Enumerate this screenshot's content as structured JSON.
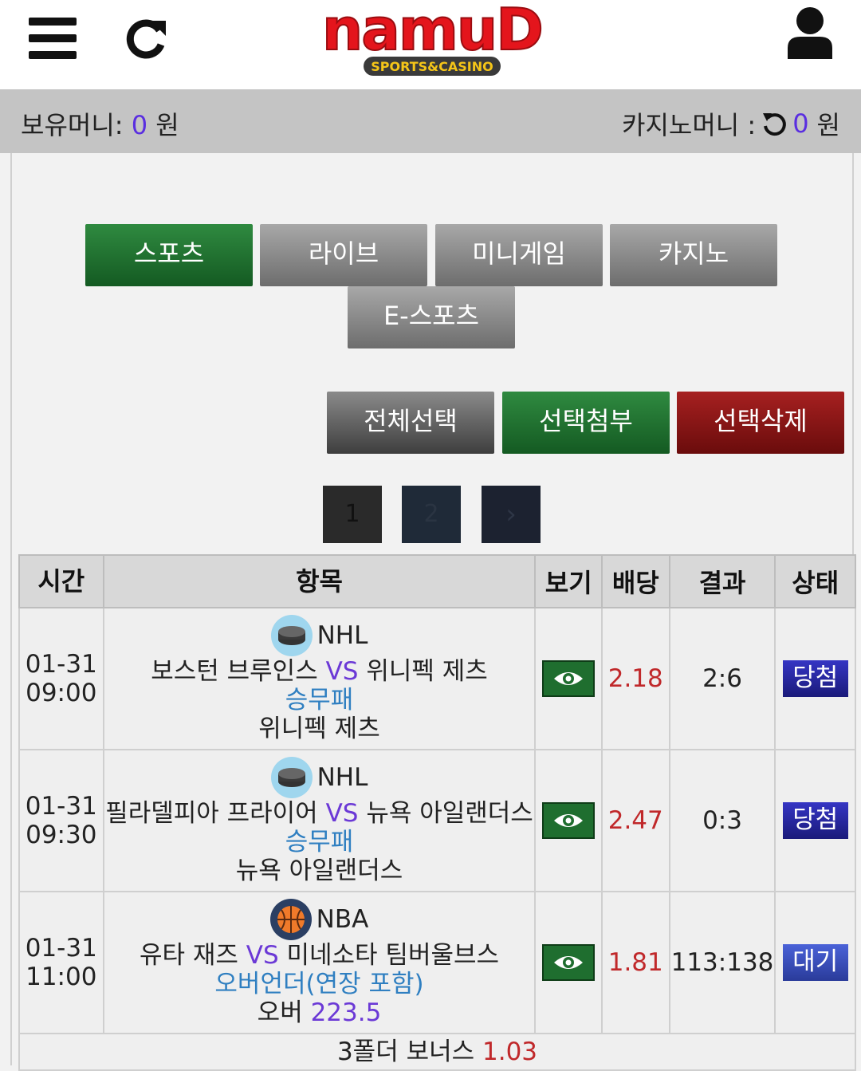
{
  "header": {
    "logo_main": "namuD",
    "logo_sub": "SPORTS&CASINO"
  },
  "money": {
    "hold_label": "보유머니:",
    "hold_value": "0",
    "hold_unit": "원",
    "casino_label": "카지노머니 :",
    "casino_value": "0",
    "casino_unit": "원"
  },
  "tabs": {
    "sports": "스포츠",
    "live": "라이브",
    "minigame": "미니게임",
    "casino": "카지노",
    "esports": "E-스포츠"
  },
  "actions": {
    "select_all": "전체선택",
    "attach": "선택첨부",
    "delete": "선택삭제"
  },
  "pagination": {
    "page1": "1",
    "page2": "2",
    "next": "›"
  },
  "table": {
    "headers": [
      "시간",
      "항목",
      "보기",
      "배당",
      "결과",
      "상태"
    ],
    "rows": [
      {
        "date": "01-31",
        "time": "09:00",
        "league": "NHL",
        "league_icon": "hockey-puck-icon",
        "home": "보스턴 브루인스",
        "vs": "VS",
        "away": "위니펙 제츠",
        "bet_type": "승무패",
        "pick_text": "위니펙 제츠",
        "pick_line": "",
        "odds": "2.18",
        "result": "2:6",
        "status": "당첨"
      },
      {
        "date": "01-31",
        "time": "09:30",
        "league": "NHL",
        "league_icon": "hockey-puck-icon",
        "home": "필라델피아 프라이어",
        "vs": "VS",
        "away": "뉴욕 아일랜더스",
        "bet_type": "승무패",
        "pick_text": "뉴욕 아일랜더스",
        "pick_line": "",
        "odds": "2.47",
        "result": "0:3",
        "status": "당첨"
      },
      {
        "date": "01-31",
        "time": "11:00",
        "league": "NBA",
        "league_icon": "basketball-icon",
        "home": "유타 재즈",
        "vs": "VS",
        "away": "미네소타 팀버울브스",
        "bet_type": "오버언더(연장 포함)",
        "pick_text": "오버",
        "pick_line": "223.5",
        "odds": "1.81",
        "result": "113:138",
        "status": "대기"
      }
    ],
    "bonus_label": "3폴더 보너스",
    "bonus_value": "1.03"
  },
  "colors": {
    "accent_purple": "#5a2ee0",
    "odds_red": "#c0282a",
    "bet_type_blue": "#2f7fc1",
    "tab_green": "#1f6e2f",
    "tab_red": "#8a1515",
    "status_blue": "#1a1a7a"
  }
}
